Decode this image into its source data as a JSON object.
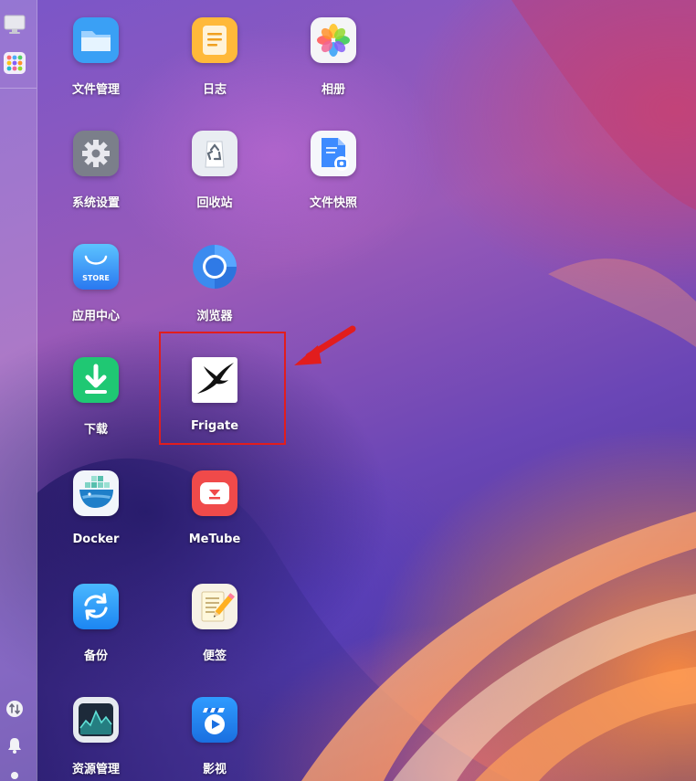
{
  "desktop": {
    "apps": [
      {
        "label": "文件管理",
        "icon": "folder-icon"
      },
      {
        "label": "日志",
        "icon": "log-icon"
      },
      {
        "label": "相册",
        "icon": "photos-icon"
      },
      {
        "label": "系统设置",
        "icon": "gear-icon"
      },
      {
        "label": "回收站",
        "icon": "recycle-icon"
      },
      {
        "label": "文件快照",
        "icon": "file-snapshot-icon"
      },
      {
        "label": "应用中心",
        "icon": "store-icon",
        "tile_text": "STORE"
      },
      {
        "label": "浏览器",
        "icon": "browser-icon"
      },
      {
        "label": "下载",
        "icon": "download-icon"
      },
      {
        "label": "Frigate",
        "icon": "frigate-bird-icon"
      },
      {
        "label": "Docker",
        "icon": "docker-icon"
      },
      {
        "label": "MeTube",
        "icon": "metube-icon"
      },
      {
        "label": "备份",
        "icon": "backup-icon"
      },
      {
        "label": "便签",
        "icon": "notes-icon"
      },
      {
        "label": "资源管理",
        "icon": "resource-monitor-icon"
      },
      {
        "label": "影视",
        "icon": "video-icon"
      }
    ]
  },
  "sidebar": {
    "items": [
      {
        "icon": "desktop-monitor-icon"
      },
      {
        "icon": "app-launcher-icon"
      },
      {
        "icon": "transfer-icon"
      },
      {
        "icon": "bell-icon"
      },
      {
        "icon": "user-icon"
      }
    ]
  },
  "annotation": {
    "highlight_color": "#e21d1d",
    "target": "Frigate"
  }
}
